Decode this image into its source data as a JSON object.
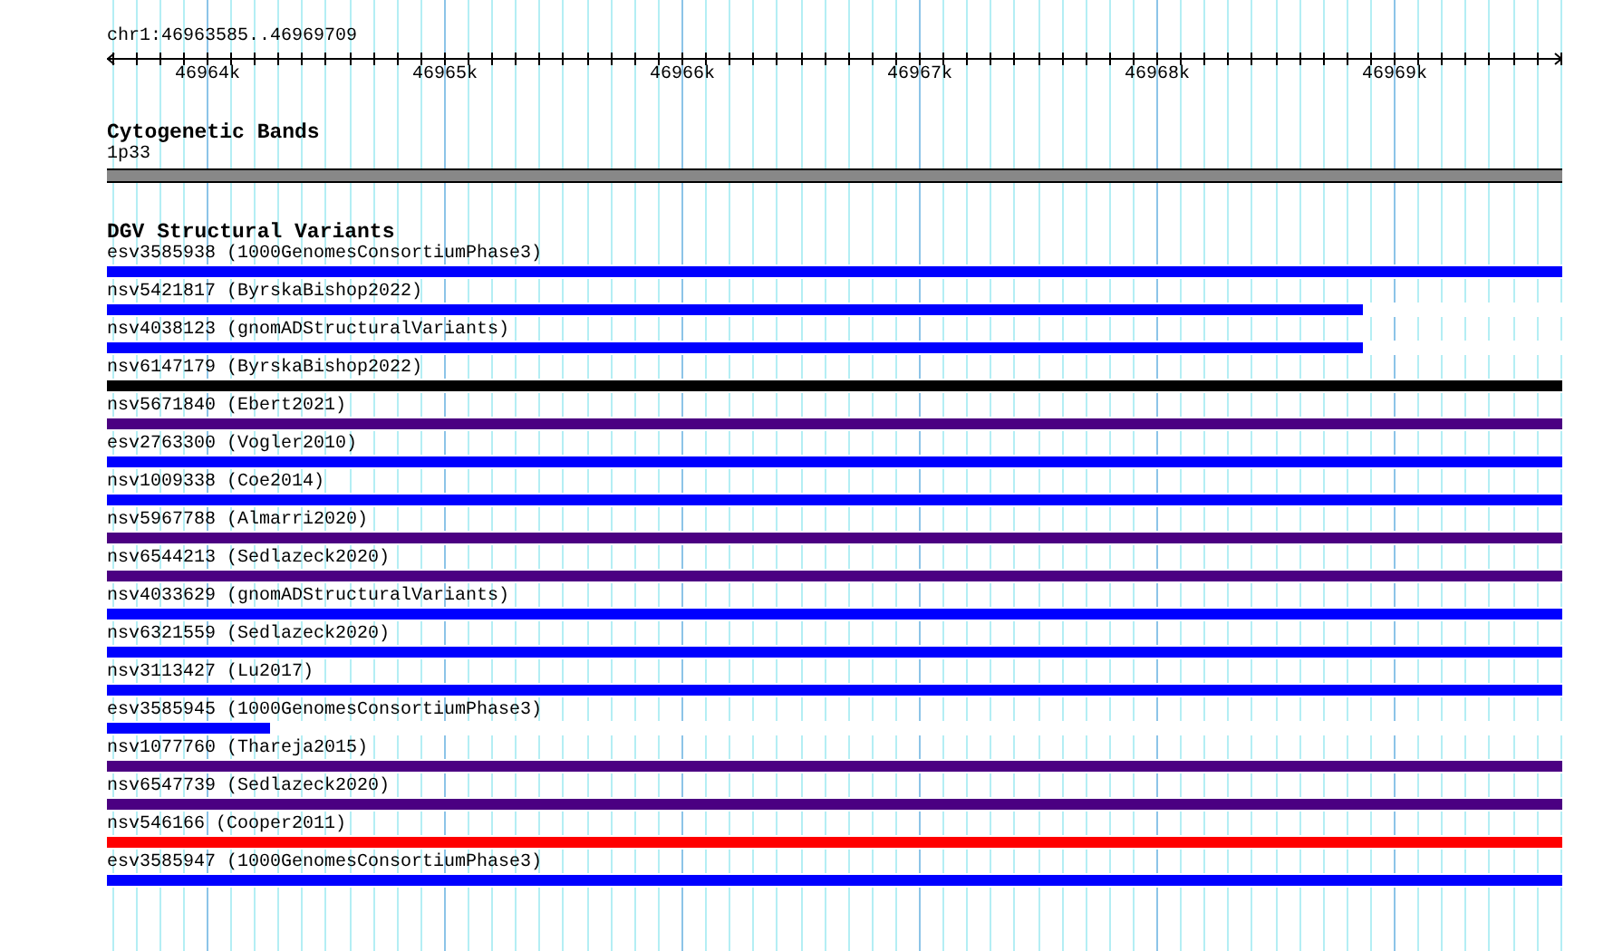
{
  "ruler": {
    "title": "chr1:46963585..46969709",
    "labels": [
      "46964k",
      "46965k",
      "46966k",
      "46967k",
      "46968k",
      "46969k"
    ]
  },
  "cytogenetic_bands": {
    "title": "Cytogenetic Bands",
    "bands": [
      {
        "name": "1p33"
      }
    ]
  },
  "structural_variants": {
    "title": "DGV Structural Variants",
    "items": [
      {
        "label": "esv3585938 (1000GenomesConsortiumPhase3)",
        "color": "#0000ff",
        "level": 1
      },
      {
        "label": "nsv5421817 (ByrskaBishop2022)",
        "color": "#0000ff",
        "level": 0.863
      },
      {
        "label": "nsv4038123 (gnomADStructuralVariants)",
        "color": "#0000ff",
        "level": 0.863
      },
      {
        "label": "nsv6147179 (ByrskaBishop2022)",
        "color": "#000000",
        "level": 1
      },
      {
        "label": "nsv5671840 (Ebert2021)",
        "color": "#4b0082",
        "level": 1
      },
      {
        "label": "esv2763300 (Vogler2010)",
        "color": "#0000ff",
        "level": 1
      },
      {
        "label": "nsv1009338 (Coe2014)",
        "color": "#0000ff",
        "level": 1
      },
      {
        "label": "nsv5967788 (Almarri2020)",
        "color": "#4b0082",
        "level": 1
      },
      {
        "label": "nsv6544213 (Sedlazeck2020)",
        "color": "#4b0082",
        "level": 1
      },
      {
        "label": "nsv4033629 (gnomADStructuralVariants)",
        "color": "#0000ff",
        "level": 1
      },
      {
        "label": "nsv6321559 (Sedlazeck2020)",
        "color": "#0000ff",
        "level": 1
      },
      {
        "label": "nsv3113427 (Lu2017)",
        "color": "#0000ff",
        "level": 1
      },
      {
        "label": "esv3585945 (1000GenomesConsortiumPhase3)",
        "color": "#0000ff",
        "level": 0.112
      },
      {
        "label": "nsv1077760 (Thareja2015)",
        "color": "#4b0082",
        "level": 1
      },
      {
        "label": "nsv6547739 (Sedlazeck2020)",
        "color": "#4b0082",
        "level": 1
      },
      {
        "label": "nsv546166 (Cooper2011)",
        "color": "#ff0000",
        "level": 1
      },
      {
        "label": "esv3585947 (1000GenomesConsortiumPhase3)",
        "color": "#0000ff",
        "level": 1
      }
    ]
  }
}
